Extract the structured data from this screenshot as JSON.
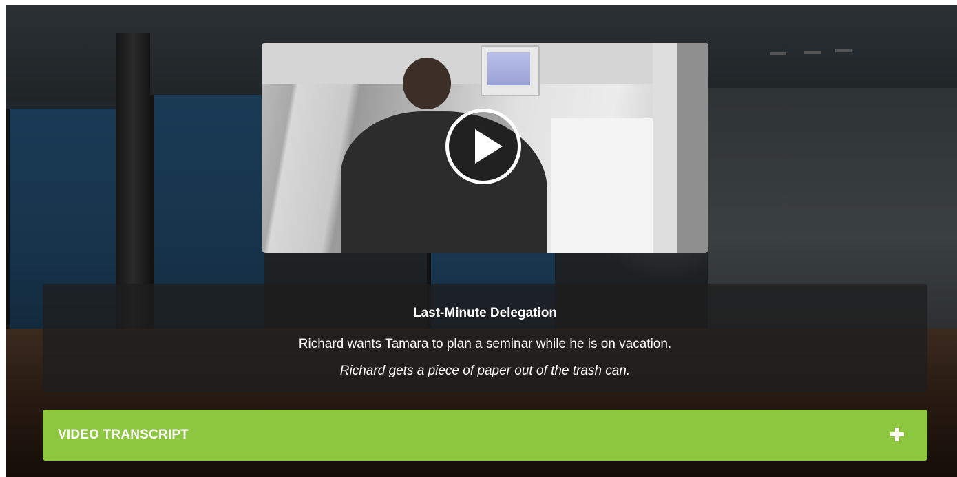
{
  "video": {
    "title": "Last-Minute Delegation",
    "description": "Richard wants Tamara to plan a seminar while he is on vacation.",
    "scene_note": "Richard gets a piece of paper out of the trash can.",
    "play_icon": "play-icon"
  },
  "transcript": {
    "label": "VIDEO TRANSCRIPT",
    "toggle_icon": "plus-icon"
  },
  "colors": {
    "accent": "#8dc63f",
    "caption_bg": "#1e1e1e",
    "text": "#ffffff"
  }
}
